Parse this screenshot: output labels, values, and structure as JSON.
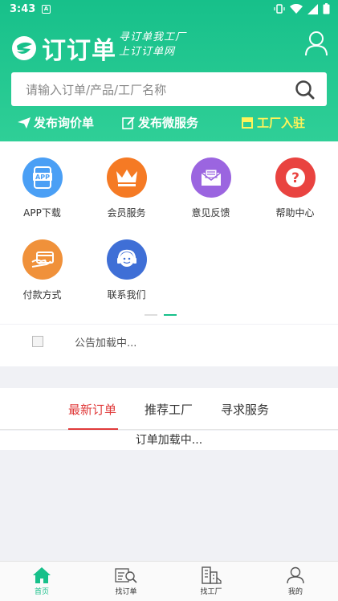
{
  "status": {
    "time": "3:43",
    "notif": "A"
  },
  "header": {
    "logo_text": "订订单",
    "slogan_line1": "寻订单我工厂",
    "slogan_line2": "上订订单网",
    "search_placeholder": "请输入订单/产品/工厂名称",
    "quick_links": {
      "inquiry": "发布询价单",
      "micro_service": "发布微服务",
      "factory_join": "工厂入驻"
    }
  },
  "grid": {
    "items": [
      {
        "label": "APP下载",
        "icon": "app-download-icon",
        "color": "#4a9ff5",
        "badge": "APP"
      },
      {
        "label": "会员服务",
        "icon": "crown-icon",
        "color": "#f57a24"
      },
      {
        "label": "意见反馈",
        "icon": "feedback-mail-icon",
        "color": "#9b65e0"
      },
      {
        "label": "帮助中心",
        "icon": "help-icon",
        "color": "#e94340",
        "badge": "?"
      },
      {
        "label": "付款方式",
        "icon": "payment-card-icon",
        "color": "#f0913a"
      },
      {
        "label": "联系我们",
        "icon": "headset-icon",
        "color": "#3f6fd6"
      }
    ]
  },
  "notice": {
    "text": "公告加载中..."
  },
  "tabs": {
    "latest": "最新订单",
    "factories": "推荐工厂",
    "services": "寻求服务"
  },
  "orders": {
    "loading": "订单加载中..."
  },
  "nav": {
    "home": "首页",
    "find_order": "找订单",
    "find_factory": "找工厂",
    "mine": "我的"
  },
  "colors": {
    "brand": "#17c08a",
    "accent_red": "#e03a3a",
    "factory_yellow": "#fff35a"
  }
}
